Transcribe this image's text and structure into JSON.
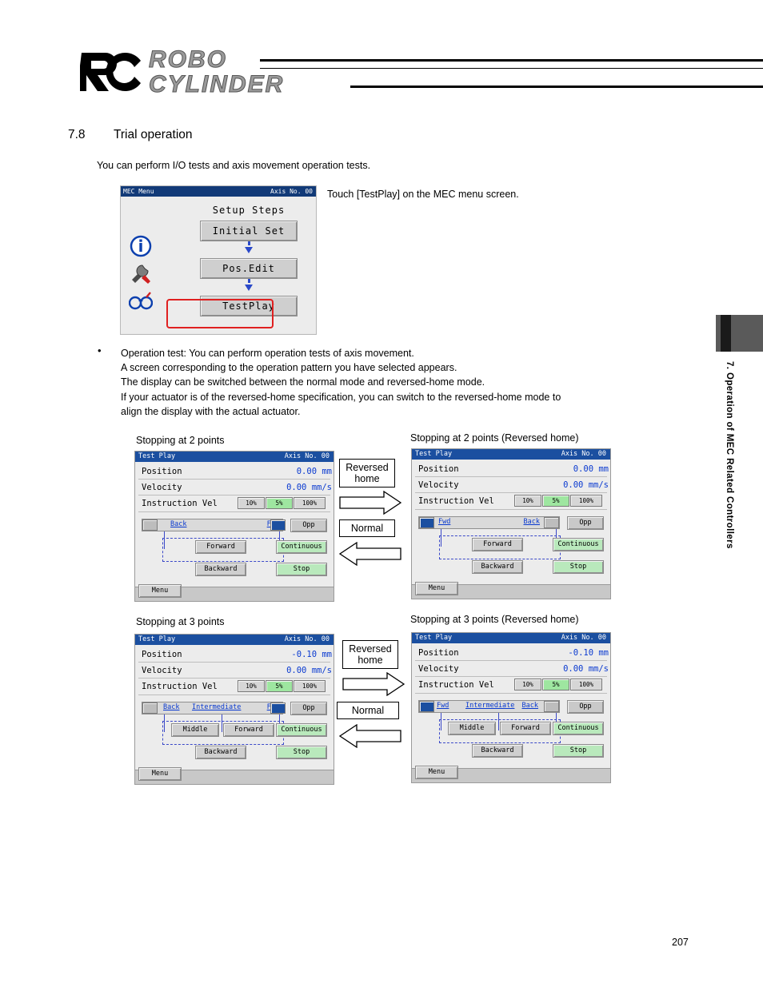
{
  "header": {
    "logo_rc": "RC",
    "logo_line1": "ROBO",
    "logo_line2": "CYLINDER"
  },
  "section": {
    "number": "7.8",
    "title": "Trial operation",
    "intro": "You can perform I/O tests and axis movement operation tests.",
    "touch_note": "Touch [TestPlay] on the MEC menu screen.",
    "bullet_marker": "•",
    "bullet_text": "Operation test: You can perform operation tests of axis movement.\nA screen corresponding to the operation pattern you have selected appears.\nThe display can be switched between the normal mode and reversed-home mode.\nIf your actuator is of the reversed-home specification, you can switch to the reversed-home mode to\nalign the display with the actual actuator."
  },
  "mec_menu": {
    "title_left": "MEC Menu",
    "title_right": "Axis No. 00",
    "heading": "Setup Steps",
    "buttons": [
      "Initial Set",
      "Pos.Edit",
      "TestPlay"
    ],
    "highlight_color": "#e02020"
  },
  "switch_labels": {
    "reversed_home": "Reversed\nhome",
    "normal": "Normal"
  },
  "captions": {
    "two_points": "Stopping at 2 points",
    "two_points_rev": "Stopping at 2 points (Reversed home)",
    "three_points": "Stopping at 3 points",
    "three_points_rev": "Stopping at 3 points (Reversed home)"
  },
  "panel_common": {
    "title_left": "Test Play",
    "title_right": "Axis No. 00",
    "label_position": "Position",
    "label_velocity": "Velocity",
    "label_instruction": "Instruction Vel",
    "pct_options": [
      "10%",
      "5%",
      "100%"
    ],
    "pct_selected": "5%",
    "btn_opp": "Opp",
    "btn_forward": "Forward",
    "btn_backward": "Backward",
    "btn_middle": "Middle",
    "btn_continuous": "Continuous",
    "btn_stop": "Stop",
    "btn_menu": "Menu"
  },
  "panels": [
    {
      "id": "two-points-normal",
      "position": "0.00 mm",
      "velocity": "0.00 mm/s",
      "slider_left": "Back",
      "slider_right": "Fwd",
      "slider_middle": ""
    },
    {
      "id": "two-points-reversed",
      "position": "0.00 mm",
      "velocity": "0.00 mm/s",
      "slider_left": "Fwd",
      "slider_right": "Back",
      "slider_middle": ""
    },
    {
      "id": "three-points-normal",
      "position": "-0.10 mm",
      "velocity": "0.00 mm/s",
      "slider_left": "Back",
      "slider_right": "Fwd",
      "slider_middle": "Intermediate"
    },
    {
      "id": "three-points-reversed",
      "position": "-0.10 mm",
      "velocity": "0.00 mm/s",
      "slider_left": "Fwd",
      "slider_right": "Back",
      "slider_middle": "Intermediate"
    }
  ],
  "side_tab_text": "7. Operation of MEC Related Controllers",
  "page_number": "207"
}
